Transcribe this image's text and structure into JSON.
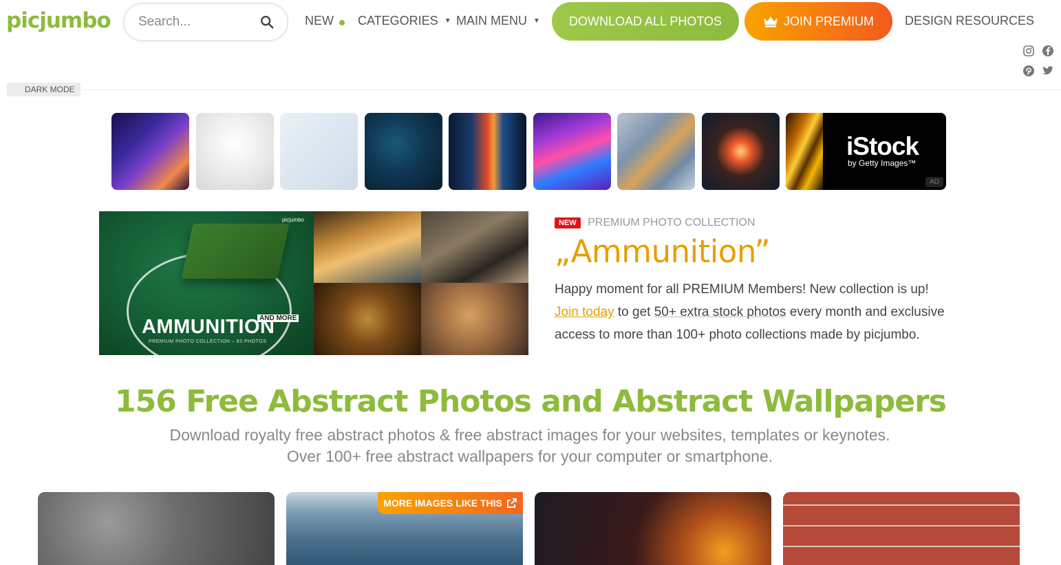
{
  "header": {
    "logo": "picjumbo",
    "search_placeholder": "Search...",
    "nav": {
      "new": "NEW",
      "categories": "CATEGORIES",
      "main_menu": "MAIN MENU"
    },
    "download_all": "DOWNLOAD ALL PHOTOS",
    "join_premium": "JOIN PREMIUM",
    "design_resources": "DESIGN RESOURCES",
    "social": [
      "instagram-icon",
      "facebook-icon",
      "pinterest-icon",
      "twitter-icon"
    ]
  },
  "dark_mode": "DARK MODE",
  "ad": {
    "brand": "iStock",
    "sub": "by Getty Images™",
    "badge": "AD"
  },
  "promo": {
    "image_title": "AMMUNITION",
    "image_more": "AND MORE",
    "image_caption": "PREMIUM PHOTO COLLECTION – 83 PHOTOS",
    "image_brand": "picjumbo",
    "badge": "NEW",
    "label": "PREMIUM PHOTO COLLECTION",
    "title": "„Ammunition”",
    "line1": "Happy moment for all PREMIUM Members! New collection is up!",
    "join_link": "Join today",
    "line2_mid": " to get ",
    "line2_ul": "50+ extra stock photos",
    "line2_end": " every month and exclusive",
    "line3": "access to more than 100+ photo collections made by picjumbo."
  },
  "heading": "156 Free Abstract Photos and Abstract Wallpapers",
  "subtitle_line1": "Download royalty free abstract photos & free abstract images for your websites, templates or keynotes.",
  "subtitle_line2": "Over 100+ free abstract wallpapers for your computer or smartphone.",
  "more_images": "MORE IMAGES LIKE THIS",
  "colors": {
    "green": "#8dbb3c",
    "orange": "#e69f00",
    "red": "#e0141b"
  }
}
